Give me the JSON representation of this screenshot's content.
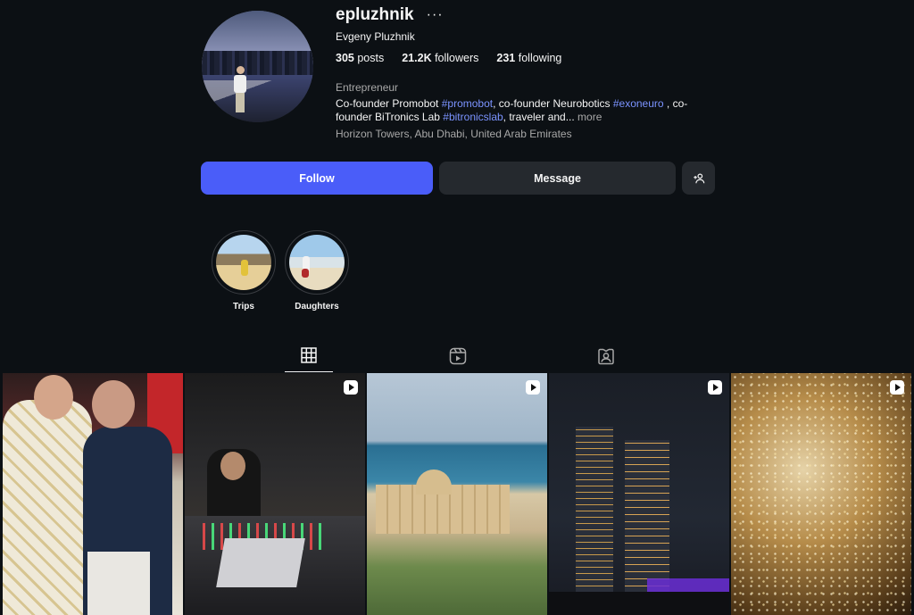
{
  "profile": {
    "username": "epluzhnik",
    "more_options": "···",
    "full_name": "Evgeny Pluzhnik",
    "stats": {
      "posts_count": "305",
      "posts_label": "posts",
      "followers_count": "21.2K",
      "followers_label": "followers",
      "following_count": "231",
      "following_label": "following"
    },
    "category": "Entrepreneur",
    "bio": {
      "part1": "Co-founder Promobot ",
      "tag1": "#promobot",
      "part2": ", co-founder Neurobotics ",
      "tag2": "#exoneuro",
      "part3": " , co-founder BiTronics Lab ",
      "tag3": "#bitronicslab",
      "part4": ", traveler and...",
      "more": " more"
    },
    "location": "Horizon Towers, Abu Dhabi, United Arab Emirates"
  },
  "actions": {
    "follow_label": "Follow",
    "message_label": "Message"
  },
  "highlights": [
    {
      "label": "Trips"
    },
    {
      "label": "Daughters"
    }
  ],
  "tabs": [
    {
      "icon": "grid-icon",
      "active": true
    },
    {
      "icon": "reels-icon",
      "active": false
    },
    {
      "icon": "tagged-icon",
      "active": false
    }
  ],
  "posts": [
    {
      "type": "photo"
    },
    {
      "type": "reel"
    },
    {
      "type": "reel"
    },
    {
      "type": "reel"
    },
    {
      "type": "reel"
    }
  ],
  "colors": {
    "background": "#0c1014",
    "accent": "#4a5df9",
    "hashtag": "#7b93ff",
    "secondary_text": "#a8a8a8",
    "button_dark": "#25292e"
  }
}
